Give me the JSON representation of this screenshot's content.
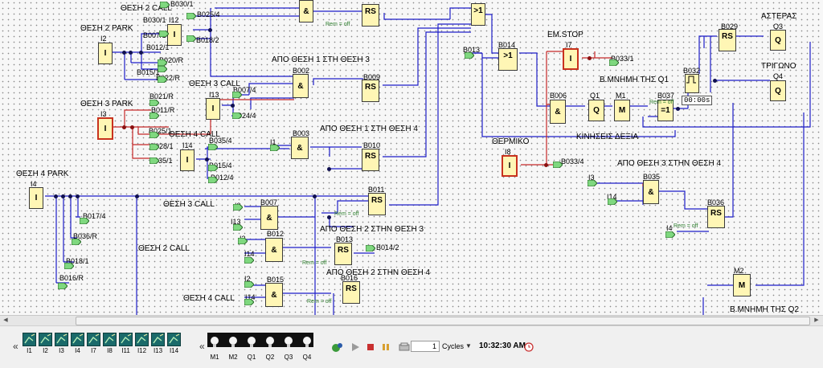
{
  "labels": {
    "l_thesi2call": "ΘΕΣΗ 2 CALL",
    "l_thesi2park": "ΘΕΣΗ 2 PARK",
    "l_thesi3call_a": "ΘΕΣΗ 3 CALL",
    "l_thesi3park": "ΘΕΣΗ 3 PARK",
    "l_thesi4call_a": "ΘΕΣΗ 4 CALL",
    "l_thesi4park": "ΘΕΣΗ 4 PARK",
    "l_thesi3call_b": "ΘΕΣΗ 3 CALL",
    "l_thesi2call_b": "ΘΕΣΗ 2 CALL",
    "l_thesi4call_b": "ΘΕΣΗ 4 CALL",
    "l_apo1sti3": "ΑΠΟ ΘΕΣΗ 1 ΣΤΗ ΘΕΣΗ 3",
    "l_apo1sti4": "ΑΠΟ ΘΕΣΗ 1 ΣΤΗ ΘΕΣΗ 4",
    "l_apo2sti3": "ΑΠΟ ΘΕΣΗ 2 ΣΤΗΝ ΘΕΣΗ 3",
    "l_apo2sti4": "ΑΠΟ ΘΕΣΗ 2 ΣΤΗΝ ΘΕΣΗ 4",
    "l_apo3sti4": "ΑΠΟ ΘΕΣΗ 3 ΣΤΗΝ ΘΕΣΗ 4",
    "l_emstop": "ΕΜ.STOP",
    "l_thermiko": "ΘΕΡΜΙΚΟ",
    "l_kiniseis": "ΚΙΝΗΣΕΙΣ ΔΕΞΙΑ",
    "l_mnimi_q1": "Β.ΜΝΗΜΗ ΤΗΣ Q1",
    "l_mnimi_q2": "Β.ΜΝΗΜΗ ΤΗΣ Q2",
    "l_asteras": "ΑΣΤΕΡΑΣ",
    "l_trigono": "ΤΡΙΓΩΝΟ"
  },
  "blocks": {
    "i2": "I2",
    "i2_t": "I",
    "i12": "I12",
    "i12_t": "I",
    "i3": "I3",
    "i3_t": "I",
    "i13": "I13",
    "i13_t": "I",
    "i14": "I14",
    "i14_t": "I",
    "i4": "I4",
    "i4_t": "I",
    "i7": "I7",
    "i7_t": "I",
    "i8": "I8",
    "i8_t": "I",
    "b002": "B002",
    "and": "&",
    "rs": "RS",
    "b009": "B009",
    "b003": "B003",
    "b010": "B010",
    "b011": "B011",
    "b007": "B007",
    "b012": "B012",
    "b013": "B013",
    "b015": "B015",
    "b016": "B016",
    "b014": "B014",
    "or": ">1",
    "b006": "B006",
    "q1": "Q1",
    "q_t": "Q",
    "m1": "M1",
    "m_t": "M",
    "b037": "B037",
    "xor": "=1",
    "b032": "B032",
    "b029": "B029",
    "q3": "Q3",
    "q4": "Q4",
    "b035": "B035",
    "b036": "B036",
    "m2": "M2",
    "timer_value": "00:00s",
    "rem_off": "Rem = off"
  },
  "flags": {
    "b030": "B030/1",
    "b007_1": "B007/1",
    "b012_1": "B012/1",
    "b020": "B020/R",
    "b015_1": "B015/1",
    "b022": "B022/R",
    "b025_4": "B025/4",
    "b018_2": "B018/2",
    "b007_4": "B007/4",
    "b024_4": "B024/4",
    "b021": "B021/R",
    "b011_r": "B011/R",
    "b025_1": "B025/1",
    "b028_1": "B028/1",
    "b035_1": "B035/1",
    "b035_4": "B035/4",
    "b015_4": "B015/4",
    "b012_4": "B012/4",
    "b017_4": "B017/4",
    "b036_r": "B036/R",
    "b018_1": "B018/1",
    "b016_r": "B016/R",
    "b013": "B013",
    "b014_2": "B014/2",
    "b033_1": "B033/1",
    "b033_4": "B033/4",
    "i1": "I1",
    "i2": "I2",
    "i13": "I13",
    "i14": "I14",
    "i3": "I3",
    "i4": "I4"
  },
  "toolbar": {
    "inputs": [
      "I1",
      "I2",
      "I3",
      "I4",
      "I7",
      "I8",
      "I11",
      "I12",
      "I13",
      "I14"
    ],
    "outputs": [
      "M1",
      "M2",
      "Q1",
      "Q2",
      "Q3",
      "Q4"
    ],
    "cycles_value": "1",
    "cycles_label": "Cycles",
    "time": "10:32:30 AM"
  }
}
